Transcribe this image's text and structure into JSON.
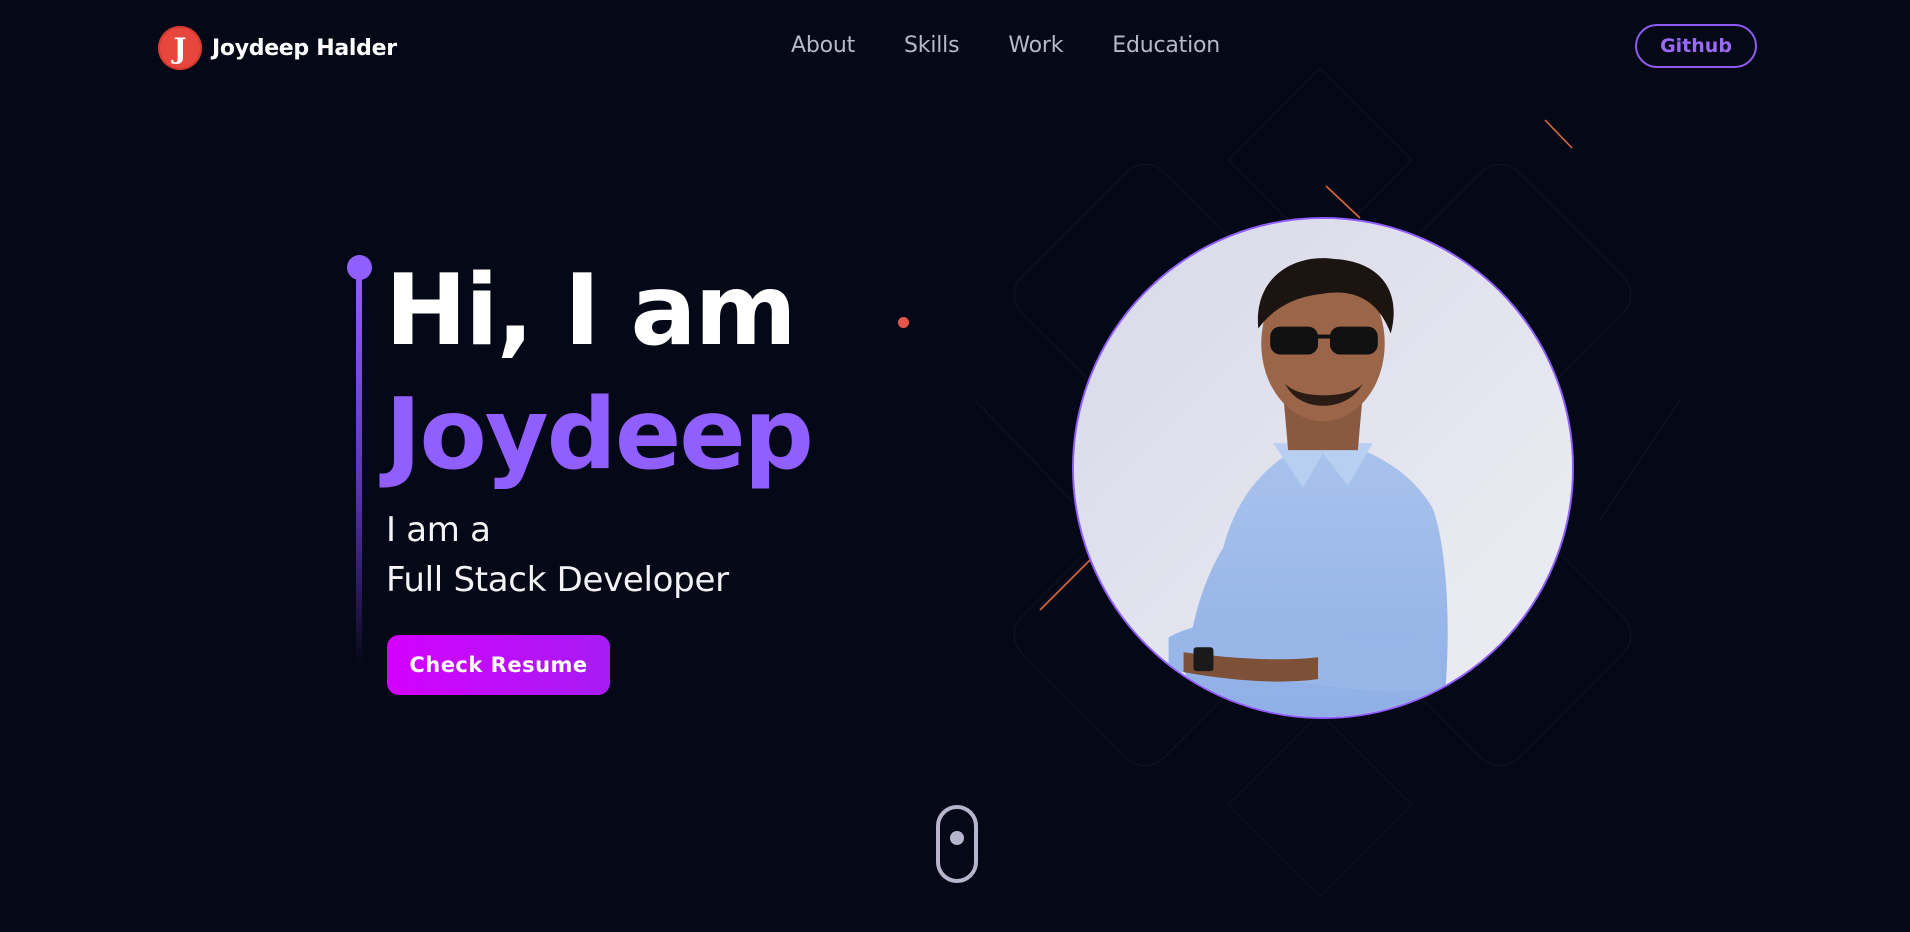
{
  "navbar": {
    "brand": {
      "logo_letter": "J",
      "name": "Joydeep Halder"
    },
    "links": [
      {
        "label": "About"
      },
      {
        "label": "Skills"
      },
      {
        "label": "Work"
      },
      {
        "label": "Education"
      }
    ],
    "cta_label": "Github"
  },
  "hero": {
    "greeting": "Hi, I am",
    "name": "Joydeep",
    "subtitle_line1": "I am a",
    "subtitle_line2": "Full Stack Developer",
    "button_label": "Check Resume"
  },
  "colors": {
    "background": "#050816",
    "accent_purple": "#915eff",
    "button_magenta": "#d400ff",
    "logo_red": "#e8453c",
    "nav_text": "#b7b9c7"
  },
  "icons": {
    "logo": "j-letter-logo-icon",
    "scroll": "mouse-scroll-icon"
  }
}
